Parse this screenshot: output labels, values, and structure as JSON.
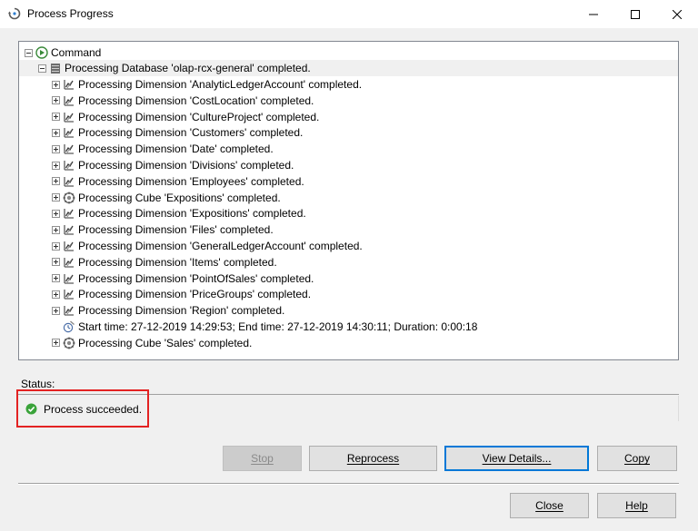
{
  "window": {
    "title": "Process Progress"
  },
  "tree": {
    "root": "Command",
    "database": "Processing Database 'olap-rcx-general' completed.",
    "items": [
      {
        "text": "Processing Dimension 'AnalyticLedgerAccount' completed.",
        "icon": "dimension-icon"
      },
      {
        "text": "Processing Dimension 'CostLocation' completed.",
        "icon": "dimension-icon"
      },
      {
        "text": "Processing Dimension 'CultureProject' completed.",
        "icon": "dimension-icon"
      },
      {
        "text": "Processing Dimension 'Customers' completed.",
        "icon": "dimension-icon"
      },
      {
        "text": "Processing Dimension 'Date' completed.",
        "icon": "dimension-icon"
      },
      {
        "text": "Processing Dimension 'Divisions' completed.",
        "icon": "dimension-icon"
      },
      {
        "text": "Processing Dimension 'Employees' completed.",
        "icon": "dimension-icon"
      },
      {
        "text": "Processing Cube 'Expositions' completed.",
        "icon": "cube-icon"
      },
      {
        "text": "Processing Dimension 'Expositions' completed.",
        "icon": "dimension-icon"
      },
      {
        "text": "Processing Dimension 'Files' completed.",
        "icon": "dimension-icon"
      },
      {
        "text": "Processing Dimension 'GeneralLedgerAccount' completed.",
        "icon": "dimension-icon"
      },
      {
        "text": "Processing Dimension 'Items' completed.",
        "icon": "dimension-icon"
      },
      {
        "text": "Processing Dimension 'PointOfSales' completed.",
        "icon": "dimension-icon"
      },
      {
        "text": "Processing Dimension 'PriceGroups' completed.",
        "icon": "dimension-icon"
      },
      {
        "text": "Processing Dimension 'Region' completed.",
        "icon": "dimension-icon"
      },
      {
        "text": "Start time: 27-12-2019 14:29:53; End time: 27-12-2019 14:30:11; Duration: 0:00:18",
        "icon": "timer-icon"
      },
      {
        "text": "Processing Cube 'Sales' completed.",
        "icon": "cube-icon"
      }
    ]
  },
  "status": {
    "label": "Status:",
    "text": "Process succeeded.",
    "color": "#3aa33a",
    "highlight_color": "#e32222"
  },
  "buttons": {
    "stop": "Stop",
    "reprocess": "Reprocess",
    "view_details": "View Details...",
    "copy": "Copy",
    "close": "Close",
    "help": "Help"
  }
}
